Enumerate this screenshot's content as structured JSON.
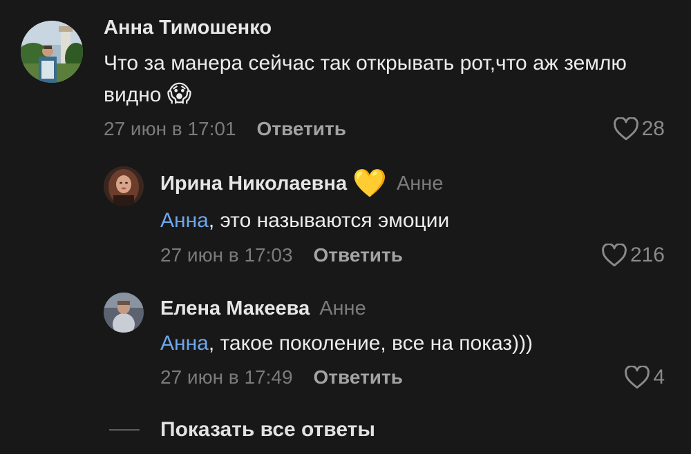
{
  "comments": [
    {
      "author": "Анна Тимошенко",
      "text": "Что за манера сейчас так открывать рот,что аж землю видно",
      "emoji": "😱",
      "time": "27 июн в 17:01",
      "reply_label": "Ответить",
      "likes": "28"
    },
    {
      "author": "Ирина Николаевна",
      "badge_emoji": "💛",
      "reply_to": "Анне",
      "mention": "Анна",
      "text": ", это называются эмоции",
      "time": "27 июн в 17:03",
      "reply_label": "Ответить",
      "likes": "216"
    },
    {
      "author": "Елена Макеева",
      "reply_to": "Анне",
      "mention": "Анна",
      "text": ", такое поколение, все на показ)))",
      "time": "27 июн в 17:49",
      "reply_label": "Ответить",
      "likes": "4"
    }
  ],
  "show_all_replies": "Показать все ответы",
  "colors": {
    "background": "#181818",
    "mention": "#6ea7ec",
    "muted": "#7b7b7b"
  }
}
